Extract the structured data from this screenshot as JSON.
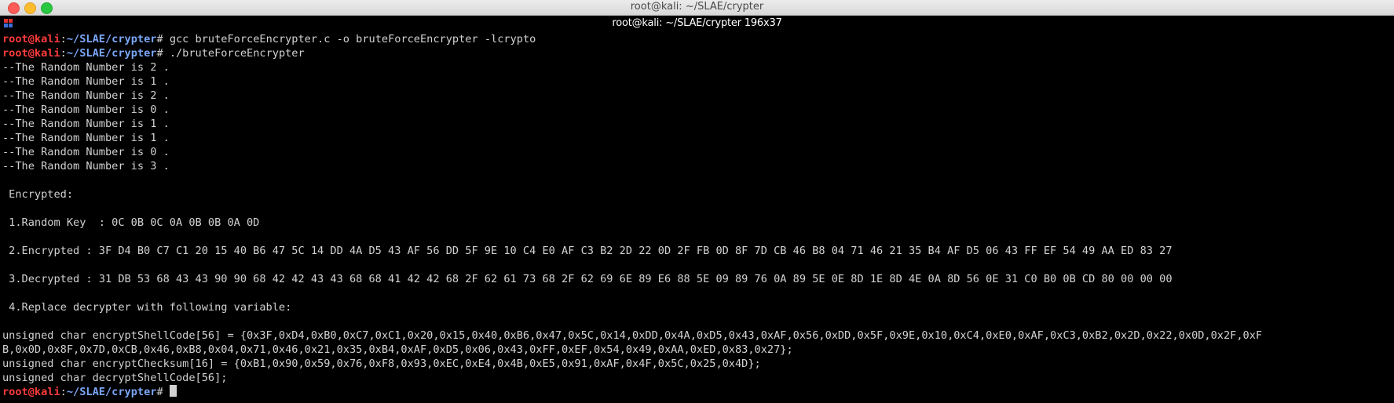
{
  "window": {
    "title": "root@kali: ~/SLAE/crypter"
  },
  "terminal": {
    "tab_title": "root@kali: ~/SLAE/crypter 196x37",
    "prompt": {
      "user": "root@kali",
      "path": "~/SLAE/crypter",
      "symbol": "#"
    },
    "commands": [
      "gcc bruteForceEncrypter.c -o bruteForceEncrypter -lcrypto",
      "./bruteForceEncrypter"
    ],
    "random_lines": [
      "--The Random Number is 2 .",
      "--The Random Number is 1 .",
      "--The Random Number is 2 .",
      "--The Random Number is 0 .",
      "--The Random Number is 1 .",
      "--The Random Number is 1 .",
      "--The Random Number is 0 .",
      "--The Random Number is 3 ."
    ],
    "encrypted_header": " Encrypted:",
    "random_key": " 1.Random Key  : 0C 0B 0C 0A 0B 0B 0A 0D",
    "encrypted": " 2.Encrypted : 3F D4 B0 C7 C1 20 15 40 B6 47 5C 14 DD 4A D5 43 AF 56 DD 5F 9E 10 C4 E0 AF C3 B2 2D 22 0D 2F FB 0D 8F 7D CB 46 B8 04 71 46 21 35 B4 AF D5 06 43 FF EF 54 49 AA ED 83 27",
    "decrypted": " 3.Decrypted : 31 DB 53 68 43 43 90 90 68 42 42 43 43 68 68 41 42 42 68 2F 62 61 73 68 2F 62 69 6E 89 E6 88 5E 09 89 76 0A 89 5E 0E 8D 1E 8D 4E 0A 8D 56 0E 31 C0 B0 0B CD 80 00 00 00",
    "replace_note": " 4.Replace decrypter with following variable:",
    "code_line_1a": "unsigned char encryptShellCode[56] = {0x3F,0xD4,0xB0,0xC7,0xC1,0x20,0x15,0x40,0xB6,0x47,0x5C,0x14,0xDD,0x4A,0xD5,0x43,0xAF,0x56,0xDD,0x5F,0x9E,0x10,0xC4,0xE0,0xAF,0xC3,0xB2,0x2D,0x22,0x0D,0x2F,0xF",
    "code_line_1b": "B,0x0D,0x8F,0x7D,0xCB,0x46,0xB8,0x04,0x71,0x46,0x21,0x35,0xB4,0xAF,0xD5,0x06,0x43,0xFF,0xEF,0x54,0x49,0xAA,0xED,0x83,0x27};",
    "code_line_2": "unsigned char encryptChecksum[16] = {0xB1,0x90,0x59,0x76,0xF8,0x93,0xEC,0xE4,0x4B,0xE5,0x91,0xAF,0x4F,0x5C,0x25,0x4D};",
    "code_line_3": "unsigned char decryptShellCode[56];"
  },
  "colors": {
    "user": "#ff3b3b",
    "path": "#7aa6f7",
    "text": "#d2d2d2",
    "background": "#000000"
  }
}
